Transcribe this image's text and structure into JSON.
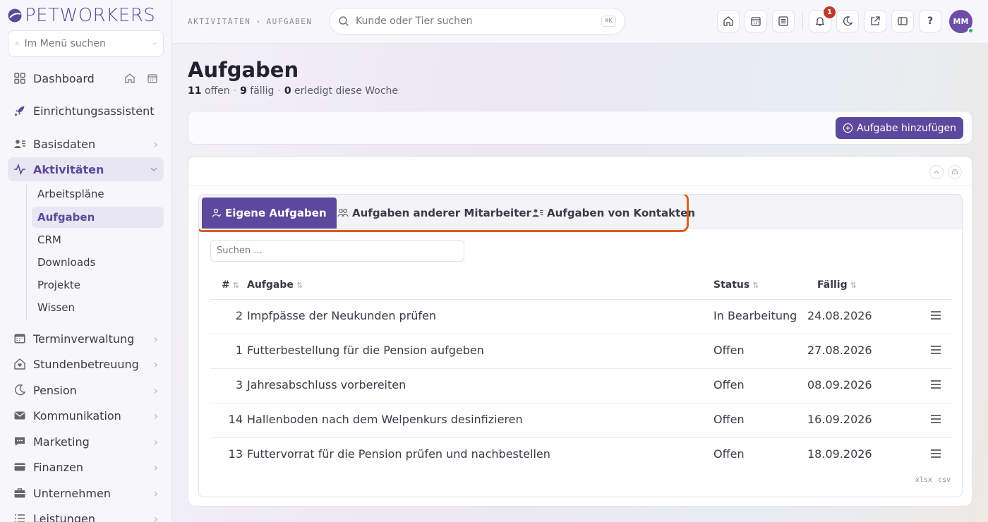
{
  "app": {
    "logo_text": "PETWORKERS"
  },
  "sidebar": {
    "search_placeholder": "Im Menü suchen",
    "items": [
      {
        "label": "Dashboard"
      },
      {
        "label": "Einrichtungsassistent"
      },
      {
        "label": "Basisdaten"
      },
      {
        "label": "Aktivitäten",
        "active": true
      },
      {
        "label": "Terminverwaltung"
      },
      {
        "label": "Stundenbetreuung"
      },
      {
        "label": "Pension"
      },
      {
        "label": "Kommunikation"
      },
      {
        "label": "Marketing"
      },
      {
        "label": "Finanzen"
      },
      {
        "label": "Unternehmen"
      },
      {
        "label": "Leistungen"
      }
    ],
    "subitems": [
      {
        "label": "Arbeitspläne"
      },
      {
        "label": "Aufgaben",
        "active": true
      },
      {
        "label": "CRM"
      },
      {
        "label": "Downloads"
      },
      {
        "label": "Projekte"
      },
      {
        "label": "Wissen"
      }
    ]
  },
  "header": {
    "breadcrumb": [
      "AKTIVITÄTEN",
      "›",
      "AUFGABEN"
    ],
    "search_placeholder": "Kunde oder Tier suchen",
    "search_shortcut": "⌘K",
    "notification_count": "1",
    "help_label": "?",
    "avatar_initials": "MM",
    "icons": [
      "home-icon",
      "calendar-icon",
      "list-icon",
      "bell-icon",
      "moon-icon",
      "external-link-icon",
      "sidebar-toggle-icon",
      "help-icon"
    ]
  },
  "page": {
    "title": "Aufgaben",
    "stats": {
      "open_count": "11",
      "open_label": "offen",
      "due_count": "9",
      "due_label": "fällig",
      "done_count": "0",
      "done_label": "erledigt diese Woche",
      "separator": "·"
    },
    "add_button_label": "Aufgabe hinzufügen"
  },
  "tabs": [
    {
      "label": "Eigene Aufgaben",
      "active": true
    },
    {
      "label": "Aufgaben anderer Mitarbeiter"
    },
    {
      "label": "Aufgaben von Kontakten"
    }
  ],
  "table": {
    "search_placeholder": "Suchen ...",
    "columns": [
      "#",
      "Aufgabe",
      "Status",
      "Fällig"
    ],
    "sort_glyph": "⇅",
    "rows": [
      {
        "id": "2",
        "task": "Impfpässe der Neukunden prüfen",
        "status": "In Bearbeitung",
        "due": "24.08.2026"
      },
      {
        "id": "1",
        "task": "Futterbestellung für die Pension aufgeben",
        "status": "Offen",
        "due": "27.08.2026"
      },
      {
        "id": "3",
        "task": "Jahresabschluss vorbereiten",
        "status": "Offen",
        "due": "08.09.2026"
      },
      {
        "id": "14",
        "task": "Hallenboden nach dem Welpenkurs desinfizieren",
        "status": "Offen",
        "due": "16.09.2026"
      },
      {
        "id": "13",
        "task": "Futtervorrat für die Pension prüfen und nachbestellen",
        "status": "Offen",
        "due": "18.09.2026"
      }
    ],
    "export": [
      "xlsx",
      "csv"
    ]
  },
  "colors": {
    "accent": "#5c489c",
    "highlight": "#d9601f",
    "badge": "#c0392b",
    "online": "#2bb673"
  }
}
